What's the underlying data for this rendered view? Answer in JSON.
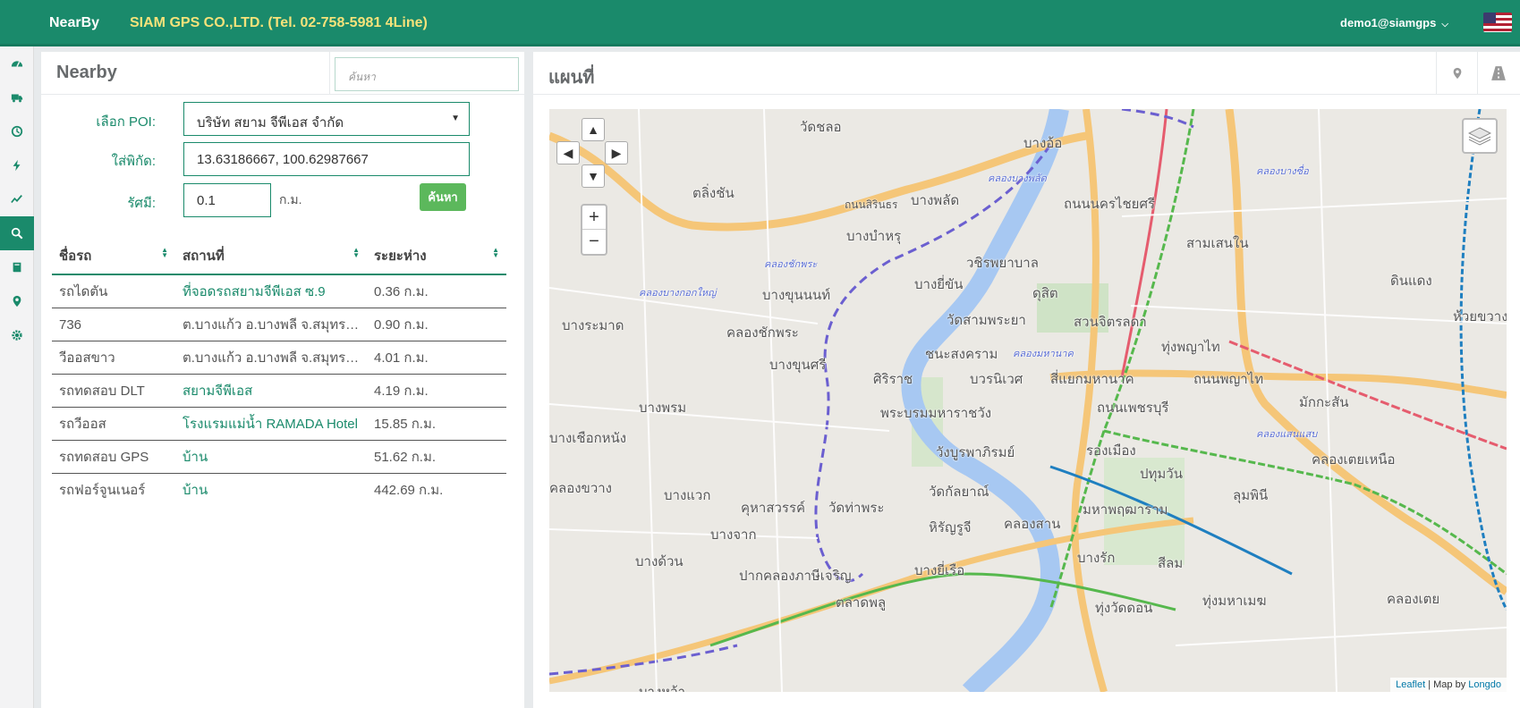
{
  "header": {
    "brand": "NearBy",
    "company": "SIAM GPS CO.,LTD. (Tel. 02-758-5981 4Line)",
    "user": "demo1@siamgps"
  },
  "sidebar": {
    "items": [
      {
        "icon": "dashboard-icon"
      },
      {
        "icon": "truck-icon"
      },
      {
        "icon": "history-icon"
      },
      {
        "icon": "bolt-icon"
      },
      {
        "icon": "line-chart-icon"
      },
      {
        "icon": "search-icon",
        "active": true
      },
      {
        "icon": "book-icon"
      },
      {
        "icon": "map-marker-icon"
      },
      {
        "icon": "gear-icon"
      }
    ]
  },
  "nearby": {
    "title": "Nearby",
    "search_placeholder": "ค้นหา",
    "poi_label": "เลือก POI:",
    "poi_value": "บริษัท สยาม จีพีเอส จำกัด",
    "coord_label": "ใส่พิกัด:",
    "coord_value": "13.63186667, 100.62987667",
    "radius_label": "รัศมี:",
    "radius_value": "0.1",
    "radius_unit": "ก.ม.",
    "search_button": "ค้นหา",
    "columns": [
      "ชื่อรถ",
      "สถานที่",
      "ระยะห่าง"
    ],
    "rows": [
      {
        "name": "รถไดตัน",
        "place": "ที่จอดรถสยามจีพีเอส ซ.9",
        "distance": "0.36 ก.ม.",
        "link": true
      },
      {
        "name": "736",
        "place": "ต.บางแก้ว อ.บางพลี จ.สมุทรปราการ",
        "distance": "0.90 ก.ม.",
        "link": false
      },
      {
        "name": "วีออสขาว",
        "place": "ต.บางแก้ว อ.บางพลี จ.สมุทรปราการ",
        "distance": "4.01 ก.ม.",
        "link": false
      },
      {
        "name": "รถทดสอบ DLT",
        "place": "สยามจีพีเอส",
        "distance": "4.19 ก.ม.",
        "link": true
      },
      {
        "name": "รถวีออส",
        "place": "โรงแรมแม่น้ำ RAMADA Hotel",
        "distance": "15.85 ก.ม.",
        "link": true
      },
      {
        "name": "รถทดสอบ GPS",
        "place": "บ้าน",
        "distance": "51.62 ก.ม.",
        "link": true
      },
      {
        "name": "รถฟอร์จูนเนอร์",
        "place": "บ้าน",
        "distance": "442.69 ก.ม.",
        "link": true
      }
    ]
  },
  "map": {
    "title": "แผนที่",
    "attribution_leaflet": "Leaflet",
    "attribution_sep": " | Map by ",
    "attribution_longdo": "Longdo",
    "labels": [
      "วัดชลอ",
      "บางอ้อ",
      "ตลิ่งชัน",
      "ถนนสิรินธร",
      "บางพลัด",
      "ถนนนครไชยศรี",
      "บางบำหรุ",
      "สามเสนใน",
      "วชิรพยาบาล",
      "ดินแดง",
      "บางยี่ขัน",
      "ดุสิต",
      "บางขุนนนท์",
      "สวนจิตรลดา",
      "บางระมาด",
      "คลองชักพระ",
      "วัดสามพระยา",
      "ห้วยขวาง",
      "ทุ่งพญาไท",
      "ชนะสงคราม",
      "บางขุนศรี",
      "ศิริราช",
      "บวรนิเวศ",
      "สี่แยกมหานาค",
      "ถนนพญาไท",
      "มักกะสัน",
      "บางพรม",
      "พระบรมมหาราชวัง",
      "ถนนเพชรบุรี",
      "บางเชือกหนัง",
      "วังบูรพาภิรมย์",
      "รองเมือง",
      "คลองเตยเหนือ",
      "ปทุมวัน",
      "คลองขวาง",
      "บางแวก",
      "วัดกัลยาณ์",
      "คุหาสวรรค์",
      "วัดท่าพระ",
      "ลุมพินี",
      "มหาพฤฒาราม",
      "หิรัญรูจี",
      "คลองสาน",
      "บางจาก",
      "บางด้วน",
      "บางยี่เรือ",
      "บางรัก",
      "สีลม",
      "ปากคลองภาษีเจริญ",
      "คลองเตย",
      "ตลาดพลู",
      "ทุ่งวัดดอน",
      "ทุ่งมหาเมฆ",
      "บางหว้า"
    ],
    "streets": [
      "คลองบางพลัด",
      "คลองชักพระ",
      "คลองบางกอกใหญ่",
      "คลองมหานาค",
      "คลองแสนแสบ",
      "คลองบางซื่อ"
    ]
  },
  "colors": {
    "brand": "#1a8a6b",
    "company": "#f6e27a",
    "search_button": "#5cb85c"
  }
}
